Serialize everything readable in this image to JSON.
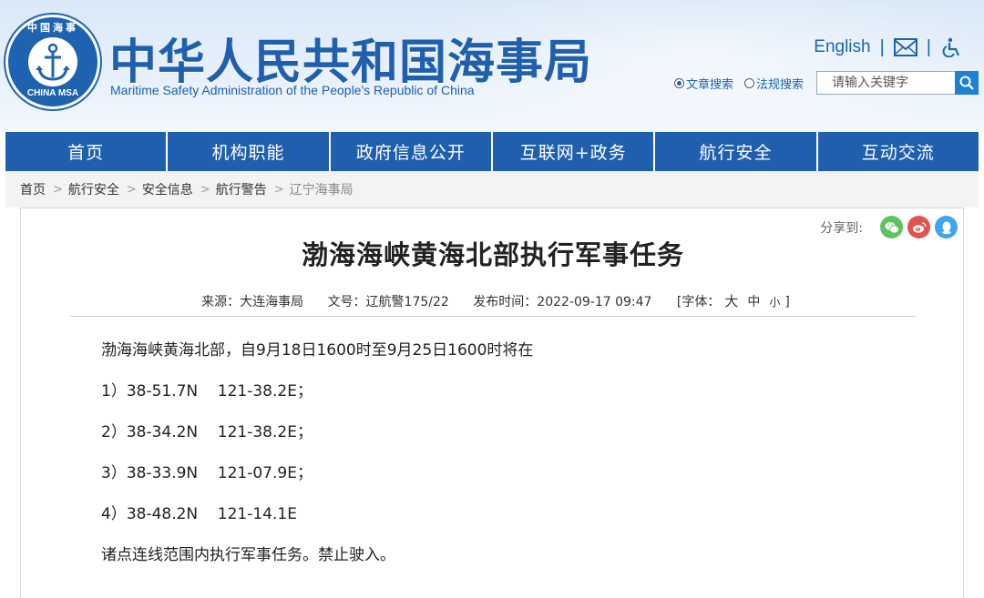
{
  "header": {
    "logo_text_top": "中国海事",
    "logo_text_bottom": "CHINA MSA",
    "title": "中华人民共和国海事局",
    "subtitle": "Maritime Safety Administration of the People's Republic of China",
    "english_link": "English",
    "separator": "|",
    "search": {
      "option1": "文章搜索",
      "option2": "法规搜索",
      "placeholder": "请输入关键字"
    }
  },
  "nav": {
    "items": [
      "首页",
      "机构职能",
      "政府信息公开",
      "互联网+政务",
      "航行安全",
      "互动交流"
    ]
  },
  "breadcrumb": {
    "items": [
      "首页",
      "航行安全",
      "安全信息",
      "航行警告",
      "辽宁海事局"
    ],
    "sep": ">"
  },
  "article": {
    "share_label": "分享到:",
    "title": "渤海海峡黄海北部执行军事任务",
    "source": "来源：大连海事局",
    "doc_no": "文号：辽航警175/22",
    "publish_time": "发布时间：2022-09-17 09:47",
    "font_label": "[字体：",
    "font_big": "大",
    "font_mid": "中",
    "font_small": "小",
    "font_close": "]",
    "paragraphs": [
      "渤海海峡黄海北部，自9月18日1600时至9月25日1600时将在",
      "1）38-51.7N    121-38.2E；",
      "2）38-34.2N    121-38.2E；",
      "3）38-33.9N    121-07.9E；",
      "4）38-48.2N    121-14.1E",
      "诸点连线范围内执行军事任务。禁止驶入。"
    ]
  },
  "colors": {
    "brand_blue": "#1f5fae",
    "wechat_green": "#5dc35d",
    "weibo_red": "#e2534f",
    "qq_blue": "#3ea5f0"
  }
}
